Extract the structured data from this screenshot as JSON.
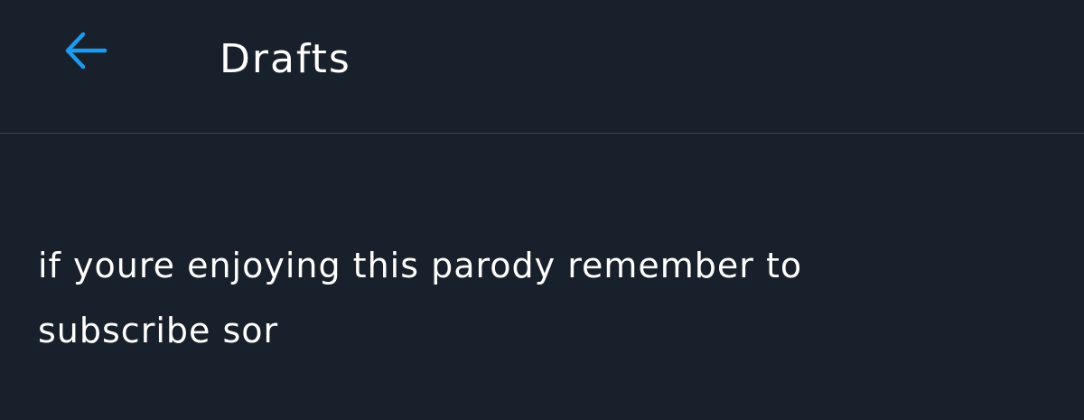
{
  "header": {
    "back_icon": "arrow-left-icon",
    "title": "Drafts"
  },
  "draft": {
    "text": "if youre enjoying this parody remember to subscribe sor"
  },
  "colors": {
    "background": "#18202b",
    "accent": "#1d9bf0",
    "text": "#ffffff",
    "divider": "#3b4451"
  }
}
